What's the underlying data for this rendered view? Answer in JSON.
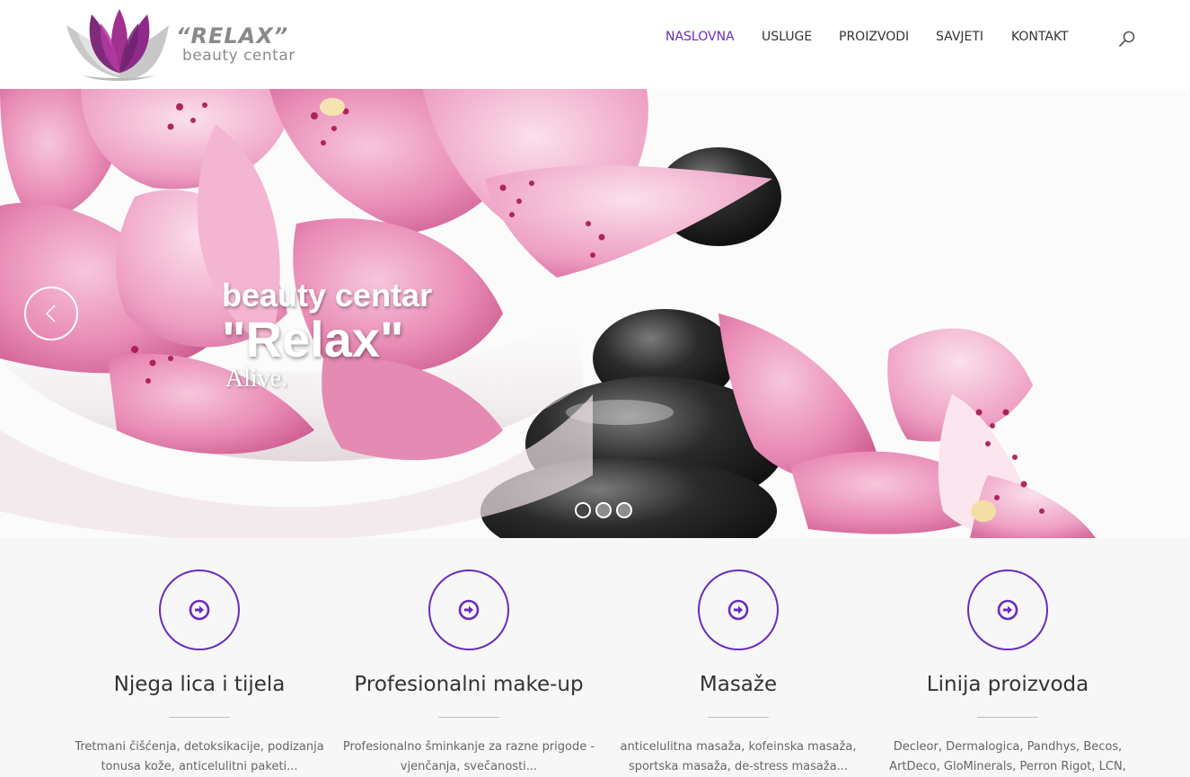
{
  "brand": {
    "title": "“RELAX”",
    "subtitle": "beauty centar",
    "accent": "#6a2bc0"
  },
  "nav": {
    "items": [
      {
        "label": "NASLOVNA",
        "active": true
      },
      {
        "label": "USLUGE",
        "active": false
      },
      {
        "label": "PROIZVODI",
        "active": false
      },
      {
        "label": "SAVJETI",
        "active": false
      },
      {
        "label": "KONTAKT",
        "active": false
      }
    ],
    "search_icon": "search-icon"
  },
  "hero": {
    "title": "beauty centar",
    "name": "\"Relax\"",
    "tagline": "Alive.",
    "prev_icon": "chevron-left-icon",
    "dots": 3,
    "active_dot": 1
  },
  "features": [
    {
      "icon": "arrow-right-circle-icon",
      "title": "Njega lica i tijela",
      "text": "Tretmani čišćenja, detoksikacije, podizanja tonusa kože, anticelulitni paketi..."
    },
    {
      "icon": "arrow-right-circle-icon",
      "title": "Profesionalni make-up",
      "text": "Profesionalno šminkanje za razne prigode - vjenčanja, svečanosti..."
    },
    {
      "icon": "arrow-right-circle-icon",
      "title": "Masaže",
      "text": "anticelulitna masaža, kofeinska masaža, sportska masaža, de-stress masaža..."
    },
    {
      "icon": "arrow-right-circle-icon",
      "title": "Linija proizvoda",
      "text": "Decleor, Dermalogica, Pandhys, Becos, ArtDeco, GloMinerals, Perron Rigot, LCN,"
    }
  ]
}
